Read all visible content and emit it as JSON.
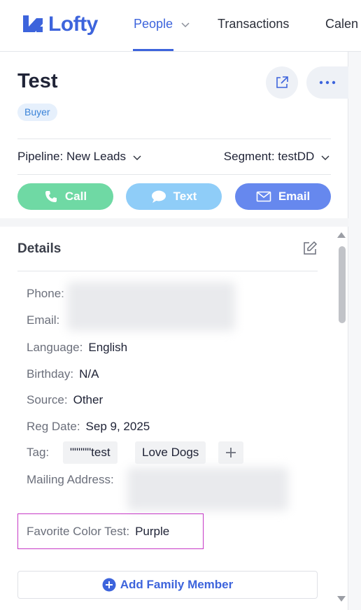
{
  "brand": {
    "name": "Lofty",
    "color": "#3d64dc"
  },
  "nav": {
    "people": "People",
    "transactions": "Transactions",
    "calendar": "Calen"
  },
  "lead": {
    "name": "Test",
    "badge": "Buyer",
    "pipeline_label": "Pipeline:",
    "pipeline_value": "New Leads",
    "segment_label": "Segment:",
    "segment_value": "testDD"
  },
  "actions": {
    "call": "Call",
    "text": "Text",
    "email": "Email"
  },
  "details": {
    "title": "Details",
    "phone_label": "Phone:",
    "email_label": "Email:",
    "language_label": "Language:",
    "language_value": "English",
    "birthday_label": "Birthday:",
    "birthday_value": "N/A",
    "source_label": "Source:",
    "source_value": "Other",
    "regdate_label": "Reg Date:",
    "regdate_value": "Sep 9, 2025",
    "tag_label": "Tag:",
    "tags": [
      "\"\"\"\"\"test",
      "Love Dogs"
    ],
    "mailing_label": "Mailing Address:",
    "favorite_label": "Favorite Color Test:",
    "favorite_value": "Purple",
    "add_family": "Add Family Member"
  }
}
